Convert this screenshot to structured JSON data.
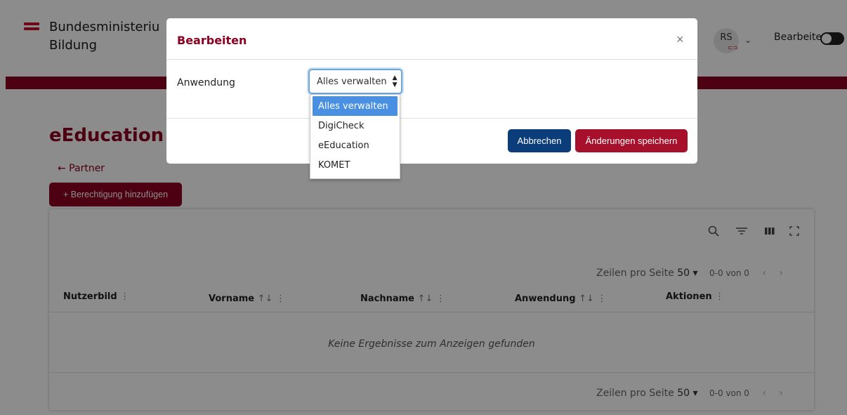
{
  "header": {
    "logo_line1": "Bundesministeriu",
    "logo_line2": "Bildung",
    "user_initials": "RS",
    "user_chevron": "⌄",
    "edit_label": "Bearbeiten"
  },
  "content": {
    "page_title": "eEducation Au",
    "back_link": "← Partner",
    "add_button": "+ Berechtigung hinzufügen",
    "toolbar_icons": [
      "search-icon",
      "filter-icon",
      "columns-icon",
      "fullscreen-icon"
    ],
    "pagination_top": {
      "rows_label": "Zeilen pro Seite",
      "rows_value": "50",
      "range": "0-0 von 0"
    },
    "columns": [
      {
        "label": "Nutzerbild",
        "sort": "",
        "menu": "⋮"
      },
      {
        "label": "Vorname",
        "sort": "↑↓",
        "menu": "⋮"
      },
      {
        "label": "Nachname",
        "sort": "↑↓",
        "menu": "⋮"
      },
      {
        "label": "Anwendung",
        "sort": "↑↓",
        "menu": "⋮"
      },
      {
        "label": "Aktionen",
        "sort": "",
        "menu": "⋮"
      }
    ],
    "empty_message": "Keine Ergebnisse zum Anzeigen gefunden",
    "pagination_bottom": {
      "rows_label": "Zeilen pro Seite",
      "rows_value": "50",
      "range": "0-0 von 0"
    }
  },
  "modal": {
    "title": "Bearbeiten",
    "close": "×",
    "field_label": "Anwendung",
    "select_value": "Alles verwalten",
    "options": [
      "Alles verwalten",
      "DigiCheck",
      "eEducation",
      "KOMET"
    ],
    "cancel_label": "Abbrechen",
    "save_label": "Änderungen speichern"
  },
  "colors": {
    "brand": "#8b0020",
    "primary_button": "#0b3d7a",
    "save_button": "#a6102b",
    "selected_option": "#4a90e2"
  }
}
